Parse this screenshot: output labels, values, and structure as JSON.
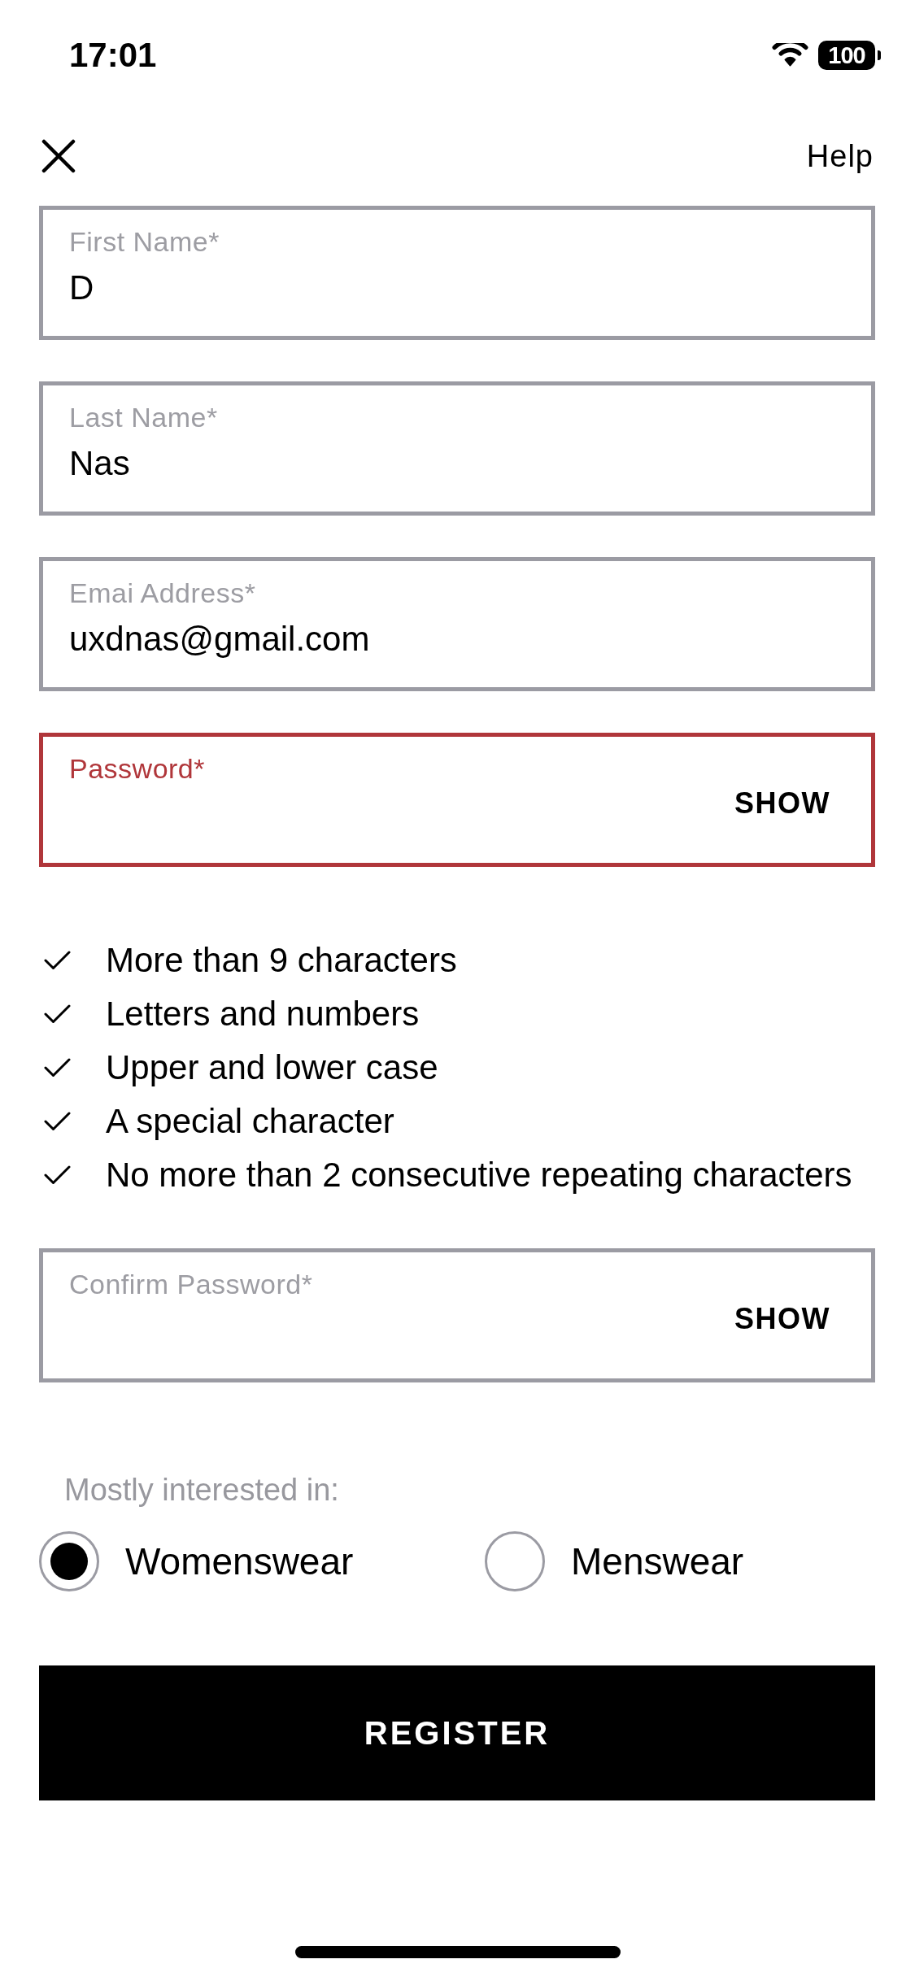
{
  "status_bar": {
    "time": "17:01",
    "battery": "100"
  },
  "nav": {
    "help": "Help"
  },
  "fields": [
    {
      "kind": "text",
      "label": "First Name*",
      "value": "D",
      "error": false
    },
    {
      "kind": "text",
      "label": "Last Name*",
      "value": "Nas",
      "error": false
    },
    {
      "kind": "text",
      "label": "Emai Address*",
      "value": "uxdnas@gmail.com",
      "error": false
    },
    {
      "kind": "password",
      "label": "Password*",
      "reveal": "SHOW",
      "error": true
    }
  ],
  "requirements": [
    {
      "text": "More than 9 characters",
      "met": true
    },
    {
      "text": "Letters and numbers",
      "met": true
    },
    {
      "text": "Upper and lower case",
      "met": true
    },
    {
      "text": "A special character",
      "met": true
    },
    {
      "text": "No more than 2 consecutive repeating characters",
      "met": true
    }
  ],
  "confirm_password": {
    "kind": "password",
    "label": "Confirm Password*",
    "reveal": "SHOW",
    "error": false
  },
  "interest": {
    "label": "Mostly interested in:",
    "options": [
      {
        "label": "Womenswear",
        "selected": true
      },
      {
        "label": "Menswear",
        "selected": false
      }
    ]
  },
  "register": "REGISTER"
}
